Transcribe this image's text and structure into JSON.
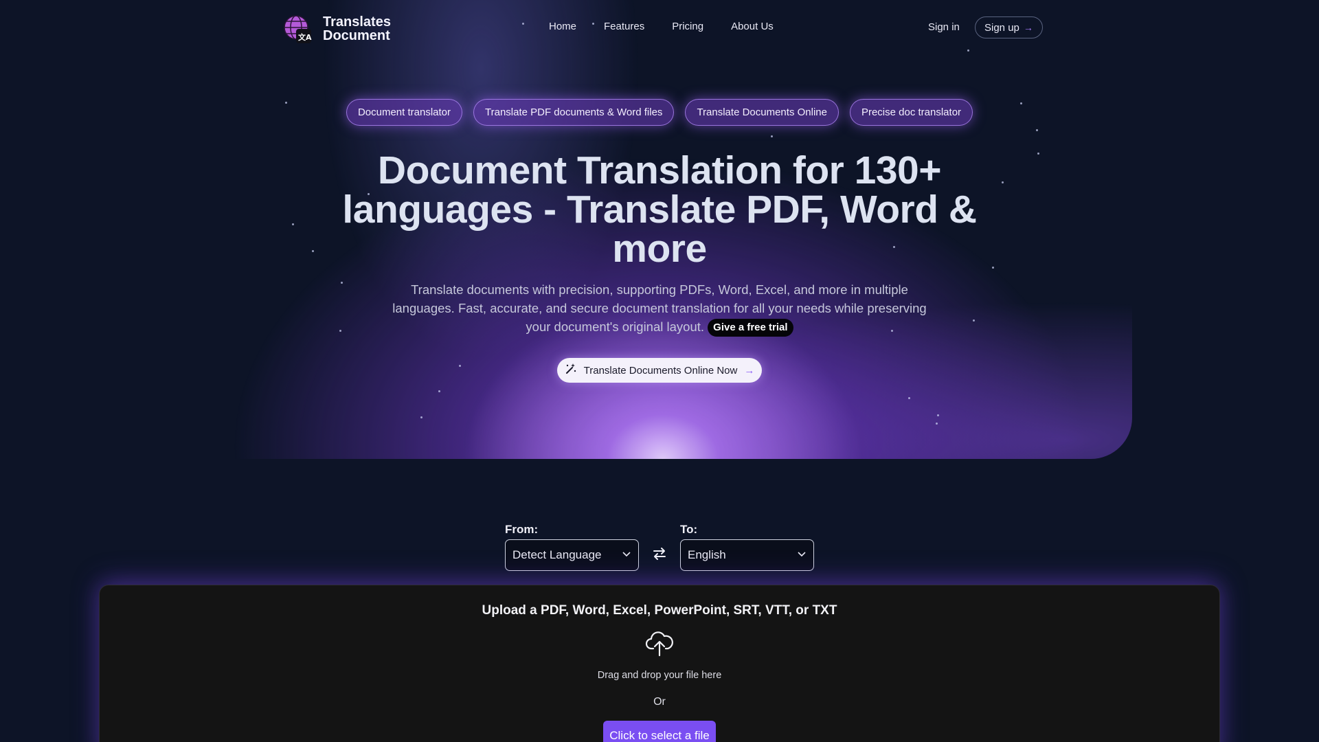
{
  "brand": {
    "line1": "Translates",
    "line2": "Document"
  },
  "nav": {
    "links": [
      "Home",
      "Features",
      "Pricing",
      "About Us"
    ],
    "sign_in": "Sign in",
    "sign_up": "Sign up",
    "sign_up_arrow": "→"
  },
  "pills": [
    "Document translator",
    "Translate PDF documents & Word files",
    "Translate Documents Online",
    "Precise doc translator"
  ],
  "hero": {
    "headline_line1": "Document Translation for 130+",
    "headline_line2": "languages - Translate PDF, Word &",
    "headline_line3": "more",
    "subtext": "Translate documents with precision, supporting PDFs, Word, Excel, and more in multiple languages. Fast, accurate, and secure document translation for all your needs while preserving your document's original layout.",
    "trial_badge": "Give a free trial",
    "cta_label": "Translate Documents Online Now",
    "cta_arrow": "→"
  },
  "translator": {
    "from_label": "From:",
    "from_value": "Detect Language",
    "to_label": "To:",
    "to_value": "English"
  },
  "upload": {
    "title": "Upload a PDF, Word, Excel, PowerPoint, SRT, VTT, or TXT",
    "drag_text": "Drag and drop your file here",
    "or_text": "Or",
    "button_label": "Click to select a file"
  },
  "colors": {
    "background": "#0d1427",
    "accent": "#7a4ef2",
    "pill_bg": "#6e3cbe",
    "headline": "#dde3f1"
  },
  "icons": {
    "logo": "globe-translate-icon",
    "cta": "magic-wand-icon",
    "swap": "swap-arrows-icon",
    "upload": "cloud-upload-icon",
    "dropdown": "chevron-down-icon"
  }
}
